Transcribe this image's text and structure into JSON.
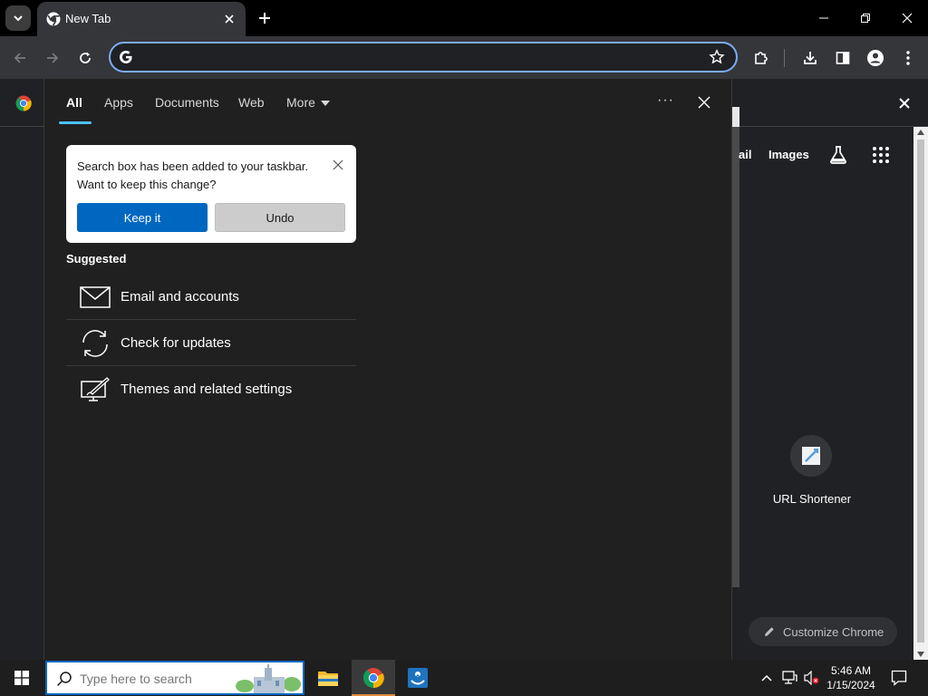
{
  "browser": {
    "tab_title": "New Tab",
    "omnibox_value": "",
    "side_panel": {
      "links": {
        "gmail_partial": "ail",
        "images": "Images"
      },
      "shortcut_label": "URL Shortener",
      "customize_label": "Customize Chrome"
    }
  },
  "search_panel": {
    "tabs": [
      {
        "label": "All"
      },
      {
        "label": "Apps"
      },
      {
        "label": "Documents"
      },
      {
        "label": "Web"
      },
      {
        "label": "More"
      }
    ],
    "more_options": "···",
    "notice": {
      "line1": "Search box has been added to your taskbar.",
      "line2": "Want to keep this change?",
      "keep_label": "Keep it",
      "undo_label": "Undo"
    },
    "suggested_header": "Suggested",
    "suggestions": [
      {
        "label": "Email and accounts",
        "icon": "mail-icon"
      },
      {
        "label": "Check for updates",
        "icon": "sync-icon"
      },
      {
        "label": "Themes and related settings",
        "icon": "personalization-icon"
      }
    ]
  },
  "taskbar": {
    "search_placeholder": "Type here to search",
    "clock": {
      "time": "5:46 AM",
      "date": "1/15/2024"
    }
  },
  "colors": {
    "accent": "#0067c0",
    "tab_underline": "#4cc2ff",
    "omnibox_border": "#7cacf8"
  }
}
